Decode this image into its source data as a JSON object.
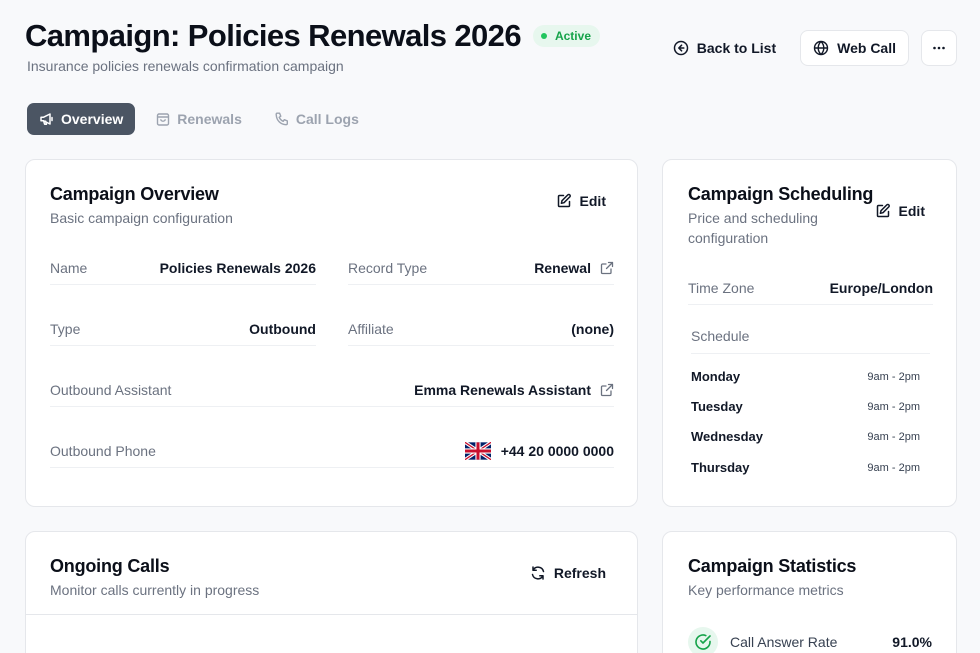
{
  "header": {
    "title": "Campaign: Policies Renewals 2026",
    "status": "Active",
    "subtitle": "Insurance policies renewals confirmation campaign",
    "back_label": "Back to List",
    "web_call_label": "Web Call"
  },
  "tabs": [
    {
      "label": "Overview",
      "active": true
    },
    {
      "label": "Renewals",
      "active": false
    },
    {
      "label": "Call Logs",
      "active": false
    }
  ],
  "overview": {
    "title": "Campaign Overview",
    "subtitle": "Basic campaign configuration",
    "edit_label": "Edit",
    "fields": {
      "name": {
        "label": "Name",
        "value": "Policies Renewals 2026"
      },
      "record_type": {
        "label": "Record Type",
        "value": "Renewal"
      },
      "type": {
        "label": "Type",
        "value": "Outbound"
      },
      "affiliate": {
        "label": "Affiliate",
        "value": "(none)"
      },
      "assistant": {
        "label": "Outbound Assistant",
        "value": "Emma Renewals Assistant"
      },
      "phone": {
        "label": "Outbound Phone",
        "value": "+44 20 0000 0000"
      }
    }
  },
  "scheduling": {
    "title": "Campaign Scheduling",
    "subtitle": "Price and scheduling configuration",
    "edit_label": "Edit",
    "timezone_label": "Time Zone",
    "timezone_value": "Europe/London",
    "schedule_label": "Schedule",
    "days": [
      {
        "day": "Monday",
        "hours": "9am - 2pm"
      },
      {
        "day": "Tuesday",
        "hours": "9am - 2pm"
      },
      {
        "day": "Wednesday",
        "hours": "9am - 2pm"
      },
      {
        "day": "Thursday",
        "hours": "9am - 2pm"
      }
    ]
  },
  "ongoing": {
    "title": "Ongoing Calls",
    "subtitle": "Monitor calls currently in progress",
    "refresh_label": "Refresh"
  },
  "stats": {
    "title": "Campaign Statistics",
    "subtitle": "Key performance metrics",
    "answer_rate_label": "Call Answer Rate",
    "answer_rate_value": "91.0%"
  },
  "colors": {
    "accent_active_tab": "#4b5563",
    "status_green": "#16a34a"
  },
  "icons": [
    "arrow-left-circle-icon",
    "globe-icon",
    "more-horizontal-icon",
    "megaphone-icon",
    "shopping-bag-icon",
    "phone-icon",
    "edit-icon",
    "external-link-icon",
    "uk-flag-icon",
    "refresh-icon",
    "check-circle-icon"
  ]
}
